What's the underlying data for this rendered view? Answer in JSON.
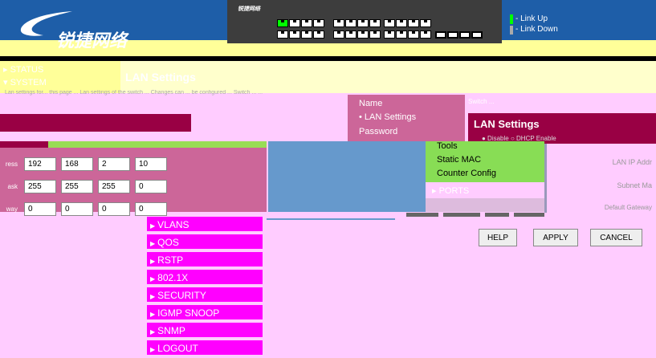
{
  "brand": {
    "logo_text": "锐捷网络",
    "panel_logo": "锐捷网络"
  },
  "legend": {
    "up_label": "- Link Up",
    "down_label": "- Link Down",
    "up_color": "#00ff00",
    "down_color": "#aaaaaa"
  },
  "side": {
    "status": "▸ STATUS",
    "system": "▾ SYSTEM"
  },
  "page": {
    "title": "LAN Settings",
    "description": "Lan settings for... this page ... Lan settings of the switch ... Changes can ... be configured ... Switch ... ..."
  },
  "submenu": [
    "Name",
    "• LAN Settings",
    "Password"
  ],
  "tools": [
    "Tools",
    "Static MAC",
    "Counter Config"
  ],
  "ports_label": "▸ PORTS",
  "lan_panel": {
    "blurb": "Switch ...",
    "heading": "LAN Settings",
    "dhcp": "● Disable  ○ DHCP Enable"
  },
  "form": {
    "ip_label": "ress",
    "mask_label": "ask",
    "gw_label": "way",
    "ip": [
      "192",
      "168",
      "2",
      "10"
    ],
    "mask": [
      "255",
      "255",
      "255",
      "0"
    ],
    "gateway": [
      "0",
      "0",
      "0",
      "0"
    ]
  },
  "right_labels": {
    "ip": "LAN IP Addr",
    "mask": "Subnet Ma",
    "gw": "Default Gateway"
  },
  "menu": [
    "VLANS",
    "QOS",
    "RSTP",
    "802.1X",
    "SECURITY",
    "IGMP SNOOP",
    "SNMP",
    "LOGOUT"
  ],
  "buttons": {
    "help": "HELP",
    "apply": "APPLY",
    "cancel": "CANCEL"
  }
}
